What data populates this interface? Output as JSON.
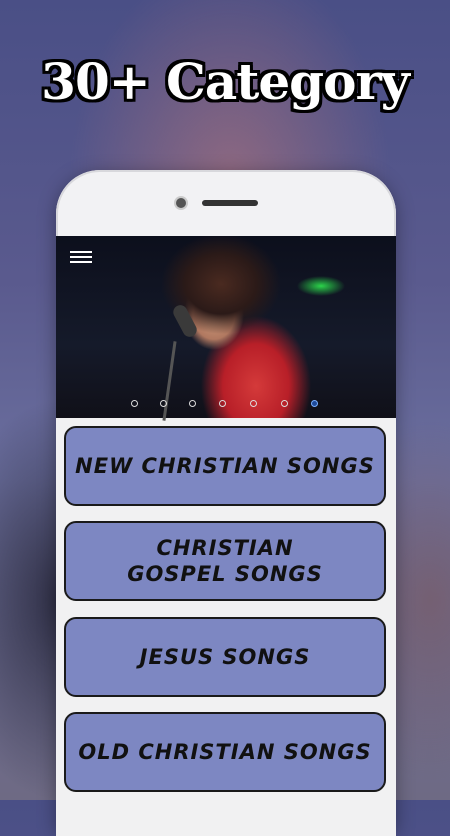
{
  "headline": "30+ Category",
  "categories": [
    {
      "label": "NEW CHRISTIAN SONGS"
    },
    {
      "label": "CHRISTIAN GOSPEL SONGS"
    },
    {
      "label": "JESUS SONGS"
    },
    {
      "label": "OLD CHRISTIAN SONGS"
    }
  ],
  "slider": {
    "count": 7,
    "active_index": 6
  },
  "colors": {
    "category_bg": "#7d87c2",
    "category_border": "#1a1a1a",
    "active_dot": "#1e4a9a"
  }
}
